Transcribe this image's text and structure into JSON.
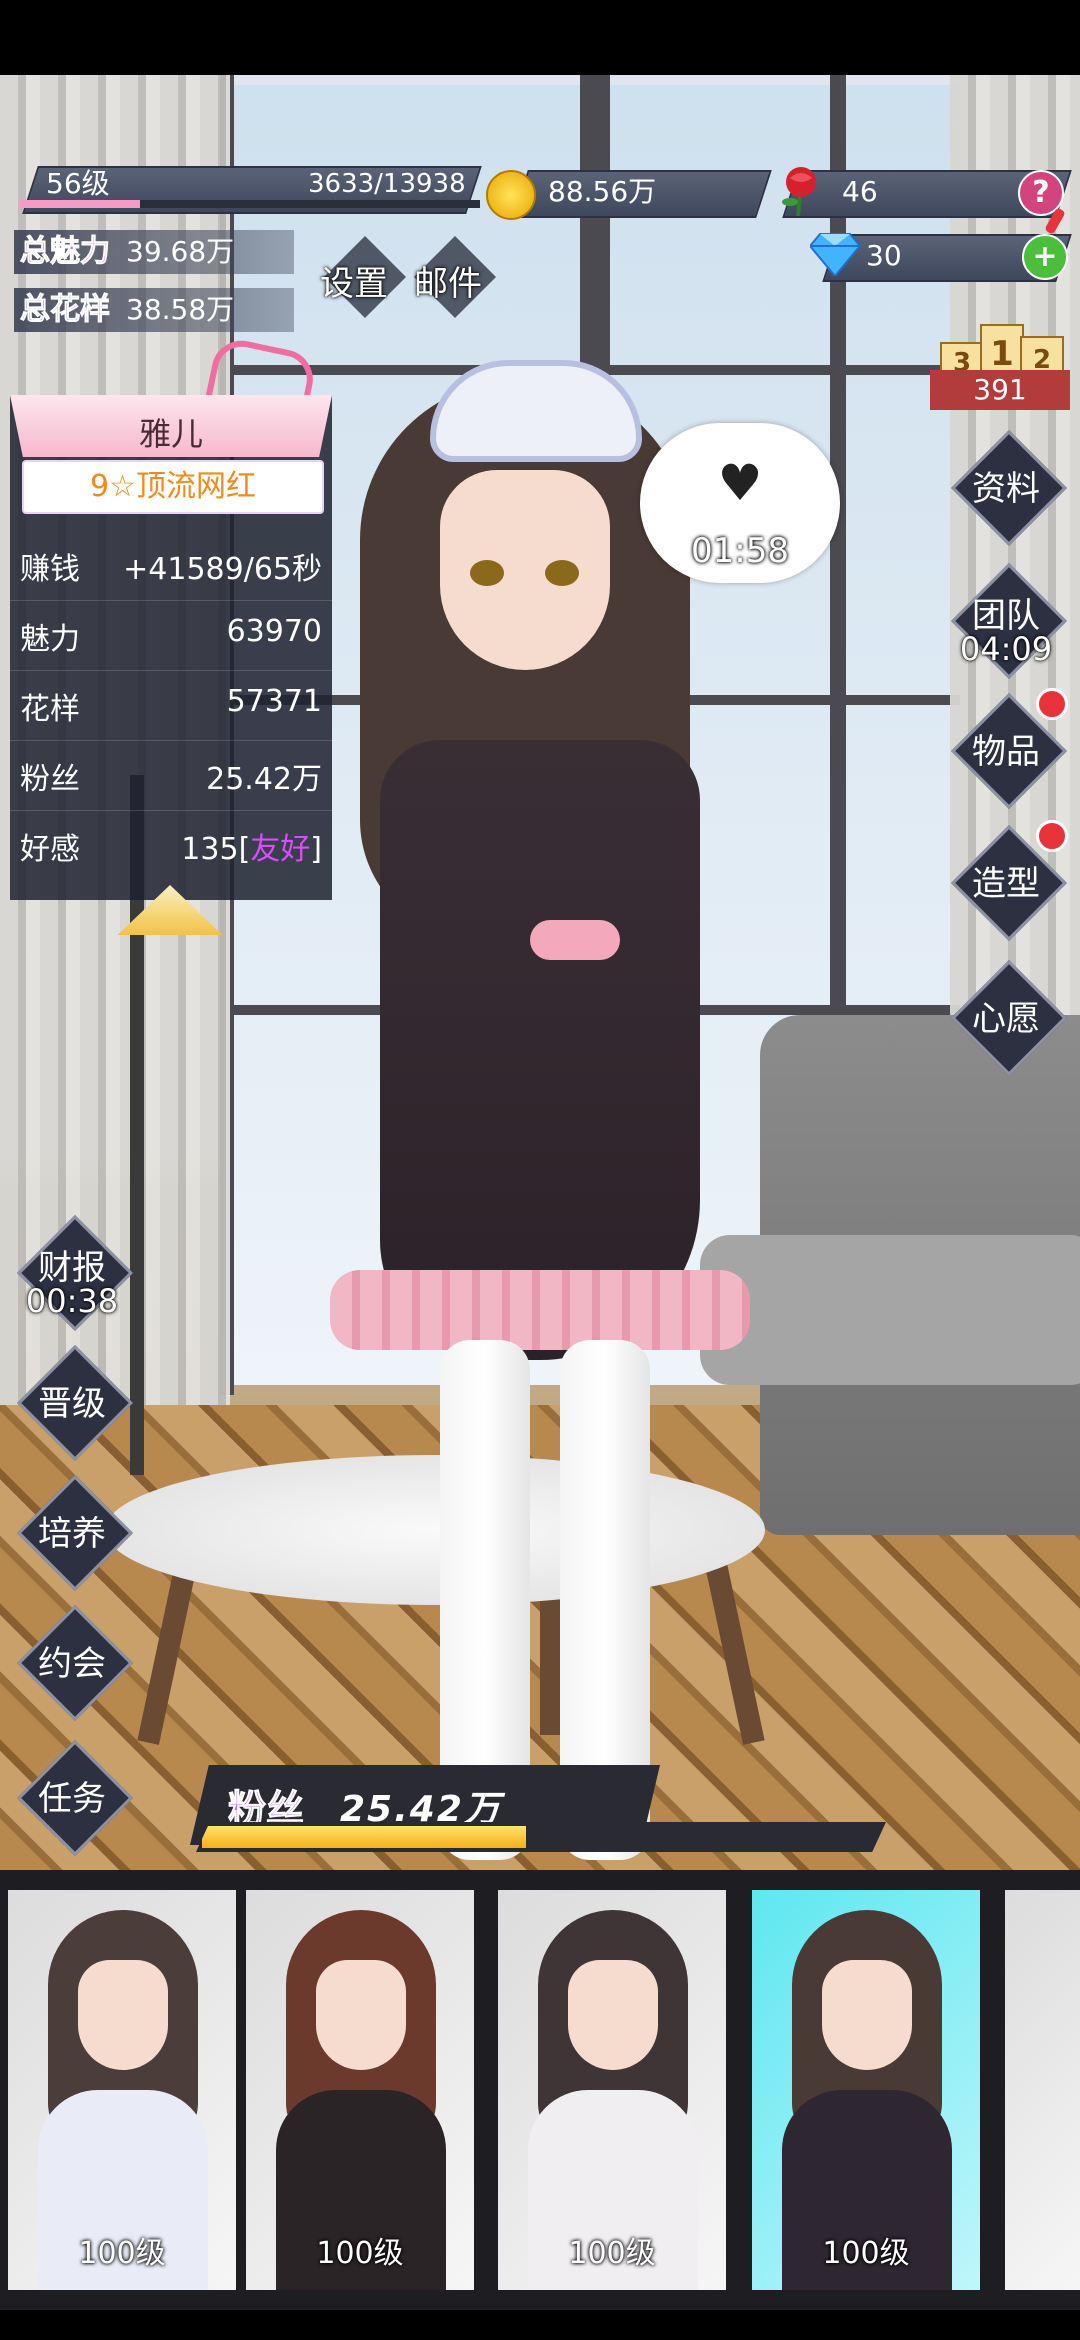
{
  "hud": {
    "level": "56级",
    "exp": "3633/13938",
    "exp_progress": 0.26,
    "coins": "88.56万",
    "roses": "46",
    "gems": "30",
    "help_symbol": "?",
    "add_symbol": "+",
    "total_charm_label": "总魅力",
    "total_charm_value": "39.68万",
    "total_style_label": "总花样",
    "total_style_value": "38.58万",
    "settings_label": "设置",
    "mail_label": "邮件",
    "rank_places": [
      "3",
      "1",
      "2"
    ],
    "rank_value": "391"
  },
  "card": {
    "name": "雅儿",
    "title": "9☆顶流网红",
    "rows": [
      {
        "key": "赚钱",
        "value": "+41589/65秒"
      },
      {
        "key": "魅力",
        "value": "63970"
      },
      {
        "key": "花样",
        "value": "57371"
      },
      {
        "key": "粉丝",
        "value": "25.42万"
      }
    ],
    "favor_key": "好感",
    "favor_value": "135",
    "favor_open": "[",
    "favor_tag": "友好",
    "favor_close": "]"
  },
  "bubble": {
    "timer": "01:58"
  },
  "right_menu": {
    "profile": "资料",
    "team": "团队",
    "team_timer": "04:09",
    "items": "物品",
    "styling": "造型",
    "wish": "心愿"
  },
  "left_menu": {
    "finance": "财报",
    "finance_timer": "00:38",
    "upgrade": "晋级",
    "train": "培养",
    "date": "约会",
    "tasks": "任务"
  },
  "fans": {
    "label": "粉丝",
    "value": "25.42万",
    "progress": 0.47
  },
  "roster": [
    {
      "level": "100级",
      "hair": "#4a3d3a",
      "outfit": "#e9ecf7"
    },
    {
      "level": "100级",
      "hair": "#6b3a2c",
      "outfit": "#2a2426"
    },
    {
      "level": "100级",
      "hair": "#3f3436",
      "outfit": "#f1eef2"
    },
    {
      "level": "100级",
      "hair": "#4a3a36",
      "outfit": "#2e2630"
    }
  ],
  "colors": {
    "accent_pink": "#f59bc6",
    "selected_card": "#5ee7f0",
    "badge_red": "#e8333a"
  }
}
